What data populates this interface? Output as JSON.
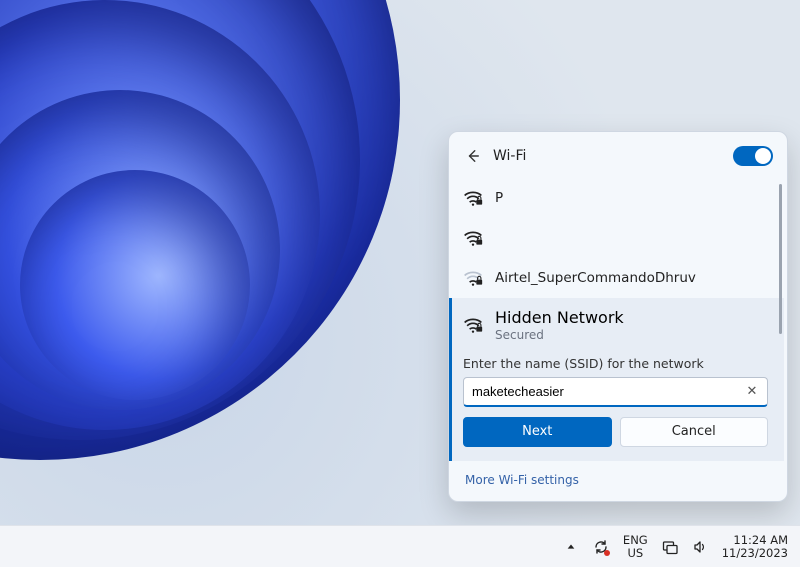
{
  "panel": {
    "title": "Wi-Fi",
    "toggle_on": true,
    "networks": [
      {
        "name": "P",
        "secured": true,
        "strength": "full"
      },
      {
        "name": "",
        "secured": true,
        "strength": "full"
      },
      {
        "name": "Airtel_SuperCommandoDhruv",
        "secured": true,
        "strength": "weak"
      }
    ],
    "selected": {
      "name": "Hidden Network",
      "status": "Secured",
      "prompt": "Enter the name (SSID) for the network",
      "ssid_value": "maketecheasier",
      "next_label": "Next",
      "cancel_label": "Cancel"
    },
    "footer_link": "More Wi-Fi settings"
  },
  "taskbar": {
    "lang_top": "ENG",
    "lang_bottom": "US",
    "time": "11:24 AM",
    "date": "11/23/2023"
  }
}
